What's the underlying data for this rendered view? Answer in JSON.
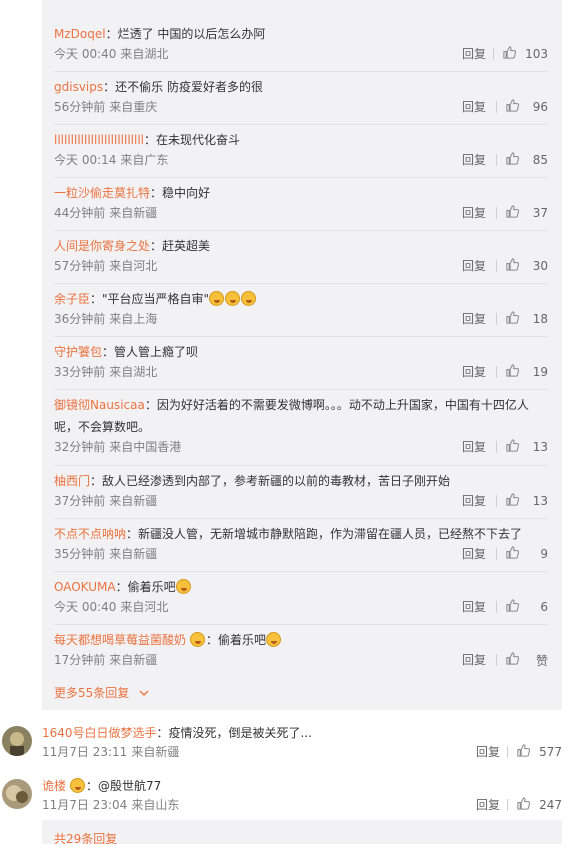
{
  "replies": [
    {
      "user": "MzDoqel",
      "text": "：烂透了 中国的以后怎么办阿",
      "time": "今天 00:40",
      "source": "来自湖北",
      "likes": "103"
    },
    {
      "user": "gdisvips",
      "text": "：还不偷乐 防疫爱好者多的很",
      "time": "56分钟前",
      "source": "来自重庆",
      "likes": "96"
    },
    {
      "user": "lllllllllllllllllllllllllll",
      "text": "：在未现代化奋斗",
      "time": "今天 00:14",
      "source": "来自广东",
      "likes": "85"
    },
    {
      "user": "一粒沙偷走莫扎特",
      "text": "：稳中向好",
      "time": "44分钟前",
      "source": "来自新疆",
      "likes": "37"
    },
    {
      "user": "人间是你寄身之处",
      "text": "：赶英超美",
      "time": "57分钟前",
      "source": "来自河北",
      "likes": "30"
    },
    {
      "user": "余子臣",
      "text": "：\"平台应当严格自审\"",
      "emojis": 3,
      "time": "36分钟前",
      "source": "来自上海",
      "likes": "18"
    },
    {
      "user": "守护饕包",
      "text": "：管人管上瘾了呗",
      "time": "33分钟前",
      "source": "来自湖北",
      "likes": "19"
    },
    {
      "user": "御镜彻Nausicaa",
      "text": "：因为好好活着的不需要发微博啊。。。动不动上升国家，中国有十四亿人",
      "text2": "呢，不会算数吧。",
      "time": "32分钟前",
      "source": "来自中国香港",
      "likes": "13"
    },
    {
      "user": "柚西门",
      "text": "：敌人已经渗透到内部了，参考新疆的以前的毒教材，苦日子刚开始",
      "time": "37分钟前",
      "source": "来自新疆",
      "likes": "13"
    },
    {
      "user": "不点不点呐呐",
      "text": "：新疆没人管，无新增城市静默陪跑，作为滞留在疆人员，已经熬不下去了",
      "time": "35分钟前",
      "source": "来自新疆",
      "likes": "9"
    },
    {
      "user": "OAOKUMA",
      "text": "：偷着乐吧",
      "emojis": 1,
      "time": "今天 00:40",
      "source": "来自河北",
      "likes": "6"
    },
    {
      "user": "每天都想喝草莓益菌酸奶",
      "userBadge": true,
      "text": "：偷着乐吧",
      "emojis": 1,
      "time": "17分钟前",
      "source": "来自新疆",
      "likes": "赞"
    }
  ],
  "more_replies": "更多55条回复",
  "reply_label": "回复",
  "top_comments": [
    {
      "user": "1640号白日做梦选手",
      "text": "：疫情没死，倒是被关死了...",
      "time": "11月7日 23:11",
      "source": "来自新疆",
      "likes": "577"
    },
    {
      "user": "诡楼",
      "userBadge": true,
      "text": "：@殷世航77",
      "time": "11月7日 23:04",
      "source": "来自山东",
      "likes": "247"
    }
  ],
  "bottom_more": "共29条回复",
  "colors": {
    "accent": "#eb7340",
    "panel": "#f2f2f5"
  }
}
